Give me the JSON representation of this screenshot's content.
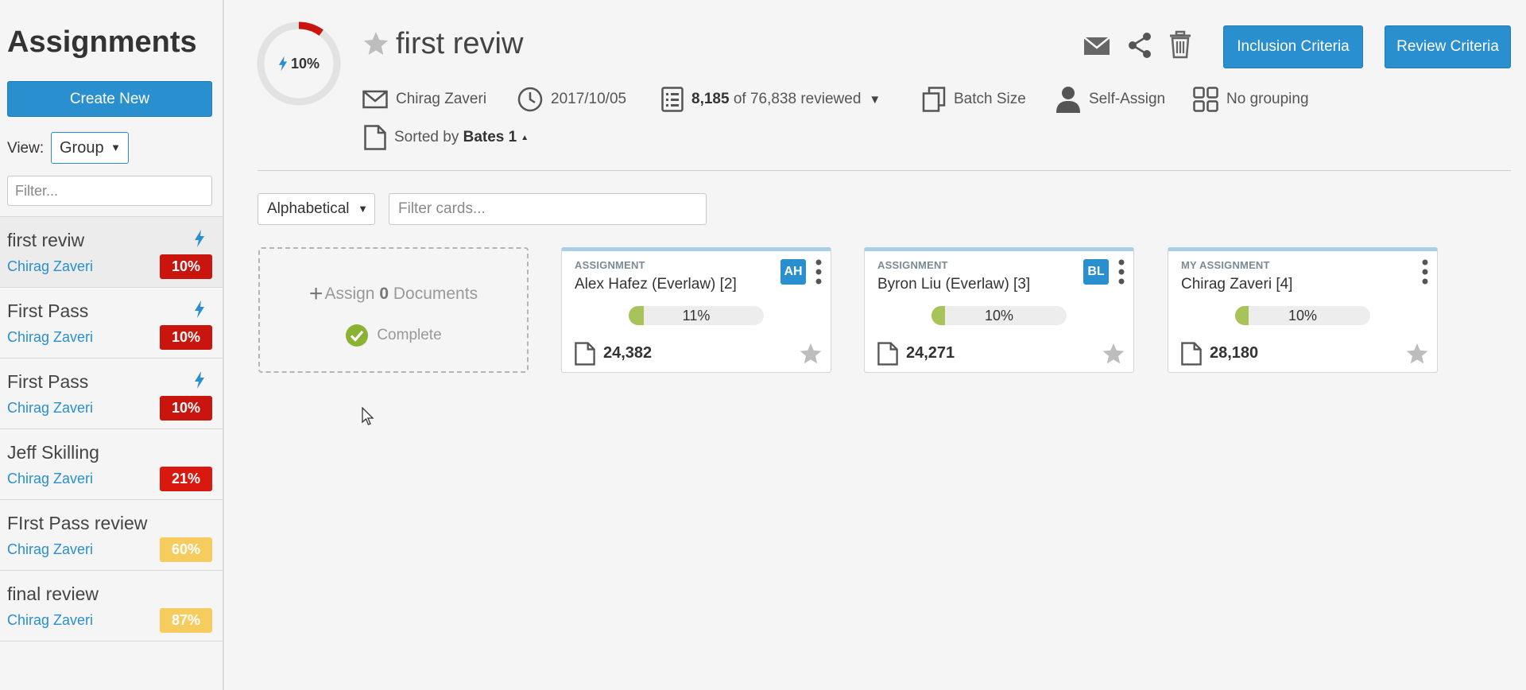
{
  "sidebar": {
    "title": "Assignments",
    "create_label": "Create New",
    "view_label": "View:",
    "view_value": "Group",
    "filter_placeholder": "Filter...",
    "items": [
      {
        "name": "first reviw",
        "owner": "Chirag Zaveri",
        "pct": "10%",
        "bolt": true,
        "color": "#c9150d"
      },
      {
        "name": "First Pass",
        "owner": "Chirag Zaveri",
        "pct": "10%",
        "bolt": true,
        "color": "#c9150d"
      },
      {
        "name": "First Pass",
        "owner": "Chirag Zaveri",
        "pct": "10%",
        "bolt": true,
        "color": "#c9150d"
      },
      {
        "name": "Jeff Skilling",
        "owner": "Chirag Zaveri",
        "pct": "21%",
        "bolt": false,
        "color": "#d9180f"
      },
      {
        "name": "FIrst Pass review",
        "owner": "Chirag Zaveri",
        "pct": "60%",
        "bolt": false,
        "color": "#f7cc5e"
      },
      {
        "name": "final review",
        "owner": "Chirag Zaveri",
        "pct": "87%",
        "bolt": false,
        "color": "#f7cc5e"
      }
    ]
  },
  "header": {
    "progress_pct": "10%",
    "progress_value": 0.1,
    "title": "first reviw",
    "inclusion_label": "Inclusion Criteria",
    "review_label": "Review Criteria",
    "owner": "Chirag Zaveri",
    "date": "2017/10/05",
    "reviewed_count": "8,185",
    "reviewed_rest": "of 76,838 reviewed",
    "batch_label": "Batch Size",
    "self_assign_label": "Self-Assign",
    "grouping_label": "No grouping",
    "sorted_prefix": "Sorted by",
    "sorted_field": "Bates 1"
  },
  "toolbar": {
    "sort_value": "Alphabetical",
    "filter_placeholder": "Filter cards..."
  },
  "assign_box": {
    "prefix": "Assign",
    "count": "0",
    "suffix": "Documents",
    "status": "Complete"
  },
  "cards": [
    {
      "kind": "ASSIGNMENT",
      "name": "Alex Hafez (Everlaw) [2]",
      "initials": "AH",
      "pct": "11%",
      "progress": 0.11,
      "docs": "24,382"
    },
    {
      "kind": "ASSIGNMENT",
      "name": "Byron Liu (Everlaw) [3]",
      "initials": "BL",
      "pct": "10%",
      "progress": 0.1,
      "docs": "24,271"
    },
    {
      "kind": "MY ASSIGNMENT",
      "name": "Chirag Zaveri [4]",
      "initials": "",
      "pct": "10%",
      "progress": 0.1,
      "docs": "28,180"
    }
  ],
  "colors": {
    "accent": "#2a8fcf",
    "progress_red": "#c9150d",
    "progress_green": "#a8c35a"
  }
}
